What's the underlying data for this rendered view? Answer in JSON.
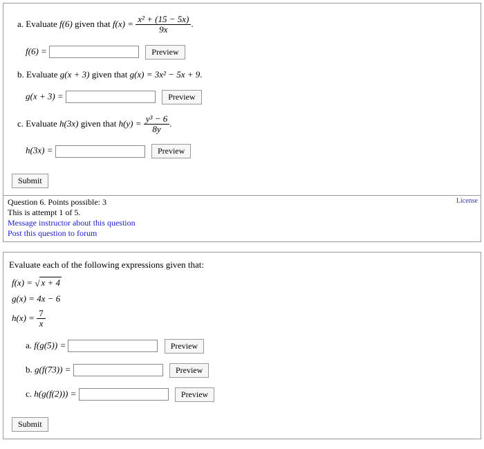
{
  "q1": {
    "a": {
      "prompt_pre": "a. Evaluate ",
      "prompt_eval": "f(6)",
      "prompt_mid": " given that ",
      "func_lhs": "f(x) = ",
      "frac_num": "x² + (15 − 5x)",
      "frac_den": "9x",
      "period": ".",
      "ans_label": "f(6) = ",
      "preview": "Preview"
    },
    "b": {
      "prompt_pre": "b. Evaluate ",
      "prompt_eval": "g(x + 3)",
      "prompt_mid": " given that ",
      "func_def": "g(x) = 3x² − 5x + 9",
      "period": ".",
      "ans_label": "g(x + 3) = ",
      "preview": "Preview"
    },
    "c": {
      "prompt_pre": "c. Evaluate ",
      "prompt_eval": "h(3x)",
      "prompt_mid": " given that ",
      "func_lhs": "h(y) = ",
      "frac_num": "y³ − 6",
      "frac_den": "8y",
      "period": ".",
      "ans_label": "h(3x) = ",
      "preview": "Preview"
    },
    "submit": "Submit"
  },
  "meta": {
    "line1a": "Question 6. Points possible: 3",
    "line2": "This is attempt 1 of 5.",
    "msg": "Message instructor about this question",
    "post": "Post this question to forum",
    "license": "License"
  },
  "q2": {
    "intro": "Evaluate each of the following expressions given that:",
    "f_lhs": "f(x) = ",
    "f_rad": "x + 4",
    "g_def": "g(x) = 4x − 6",
    "h_lhs": "h(x) = ",
    "h_num": "7",
    "h_den": "x",
    "a": {
      "label": "a. ",
      "expr": "f(g(5)) = ",
      "preview": "Preview"
    },
    "b": {
      "label": "b. ",
      "expr": "g(f(73)) = ",
      "preview": "Preview"
    },
    "c": {
      "label": "c. ",
      "expr": "h(g(f(2))) = ",
      "preview": "Preview"
    },
    "submit": "Submit"
  }
}
